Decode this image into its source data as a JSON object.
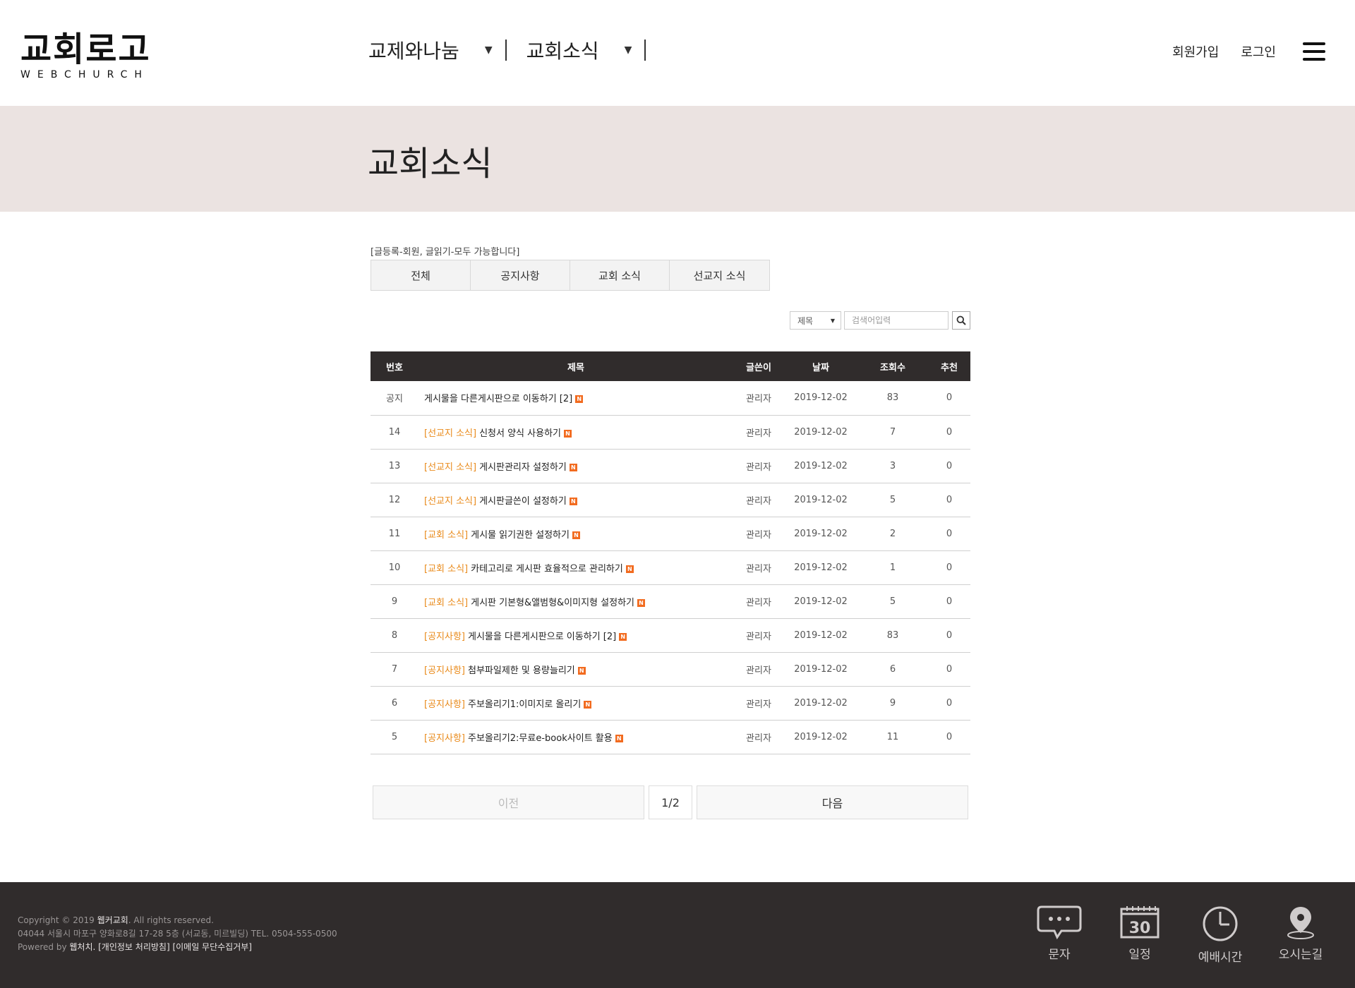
{
  "header": {
    "logo_title": "교회로고",
    "logo_sub": "WEBCHURCH",
    "nav": [
      {
        "label": "교제와나눔"
      },
      {
        "label": "교회소식"
      }
    ],
    "nav_arrow": "▼",
    "signup": "회원가입",
    "login": "로그인"
  },
  "banner": {
    "title": "교회소식"
  },
  "board": {
    "notice": "[글등록-회원, 글읽기-모두 가능합니다]",
    "tabs": [
      "전체",
      "공지사항",
      "교회 소식",
      "선교지 소식"
    ],
    "search": {
      "field": "제목",
      "placeholder": "검색어입력"
    },
    "columns": [
      "번호",
      "제목",
      "글쓴이",
      "날짜",
      "조회수",
      "추천"
    ],
    "rows": [
      {
        "num": "공지",
        "category": "",
        "title": "게시물을 다른게시판으로 이동하기 [2]",
        "author": "관리자",
        "date": "2019-12-02",
        "views": "83",
        "likes": "0"
      },
      {
        "num": "14",
        "category": "[선교지 소식]",
        "title": "신청서 양식 사용하기",
        "author": "관리자",
        "date": "2019-12-02",
        "views": "7",
        "likes": "0"
      },
      {
        "num": "13",
        "category": "[선교지 소식]",
        "title": "게시판관리자 설정하기",
        "author": "관리자",
        "date": "2019-12-02",
        "views": "3",
        "likes": "0"
      },
      {
        "num": "12",
        "category": "[선교지 소식]",
        "title": "게시판글쓴이 설정하기",
        "author": "관리자",
        "date": "2019-12-02",
        "views": "5",
        "likes": "0"
      },
      {
        "num": "11",
        "category": "[교회 소식]",
        "title": "게시물 읽기권한 설정하기",
        "author": "관리자",
        "date": "2019-12-02",
        "views": "2",
        "likes": "0"
      },
      {
        "num": "10",
        "category": "[교회 소식]",
        "title": "카테고리로 게시판 효율적으로 관리하기",
        "author": "관리자",
        "date": "2019-12-02",
        "views": "1",
        "likes": "0"
      },
      {
        "num": "9",
        "category": "[교회 소식]",
        "title": "게시판 기본형&앨범형&이미지형 설정하기",
        "author": "관리자",
        "date": "2019-12-02",
        "views": "5",
        "likes": "0"
      },
      {
        "num": "8",
        "category": "[공지사항]",
        "title": "게시물을 다른게시판으로 이동하기 [2]",
        "author": "관리자",
        "date": "2019-12-02",
        "views": "83",
        "likes": "0"
      },
      {
        "num": "7",
        "category": "[공지사항]",
        "title": "첨부파일제한 및 용량늘리기",
        "author": "관리자",
        "date": "2019-12-02",
        "views": "6",
        "likes": "0"
      },
      {
        "num": "6",
        "category": "[공지사항]",
        "title": "주보올리기1:이미지로 올리기",
        "author": "관리자",
        "date": "2019-12-02",
        "views": "9",
        "likes": "0"
      },
      {
        "num": "5",
        "category": "[공지사항]",
        "title": "주보올리기2:무료e-book사이트 활용",
        "author": "관리자",
        "date": "2019-12-02",
        "views": "11",
        "likes": "0"
      }
    ],
    "new_badge": "N",
    "pager": {
      "prev": "이전",
      "page": "1/2",
      "next": "다음"
    }
  },
  "footer": {
    "copyright_pre": "Copyright © 2019 ",
    "church": "웹커교회",
    "copyright_post": ". All rights reserved.",
    "address": "04044 서울시 마포구 양화로8길 17-28 5층 (서교동, 미르빌딩) TEL. 0504-555-0500",
    "powered_pre": "Powered by ",
    "powered_by": "웹처치",
    "privacy": ". [개인정보 처리방침] [이메일 무단수집거부]",
    "quick": [
      {
        "label": "문자",
        "icon": "chat-bubble-icon"
      },
      {
        "label": "일정",
        "icon": "calendar-icon",
        "calendar_day": "30"
      },
      {
        "label": "예배시간",
        "icon": "clock-icon"
      },
      {
        "label": "오시는길",
        "icon": "map-pin-icon"
      }
    ]
  },
  "colors": {
    "banner_bg": "#ebe3e1",
    "table_header_bg": "#302c2c",
    "category_text": "#e98a1a",
    "new_badge": "#f26b1f",
    "footer_bg": "#302c2c"
  }
}
